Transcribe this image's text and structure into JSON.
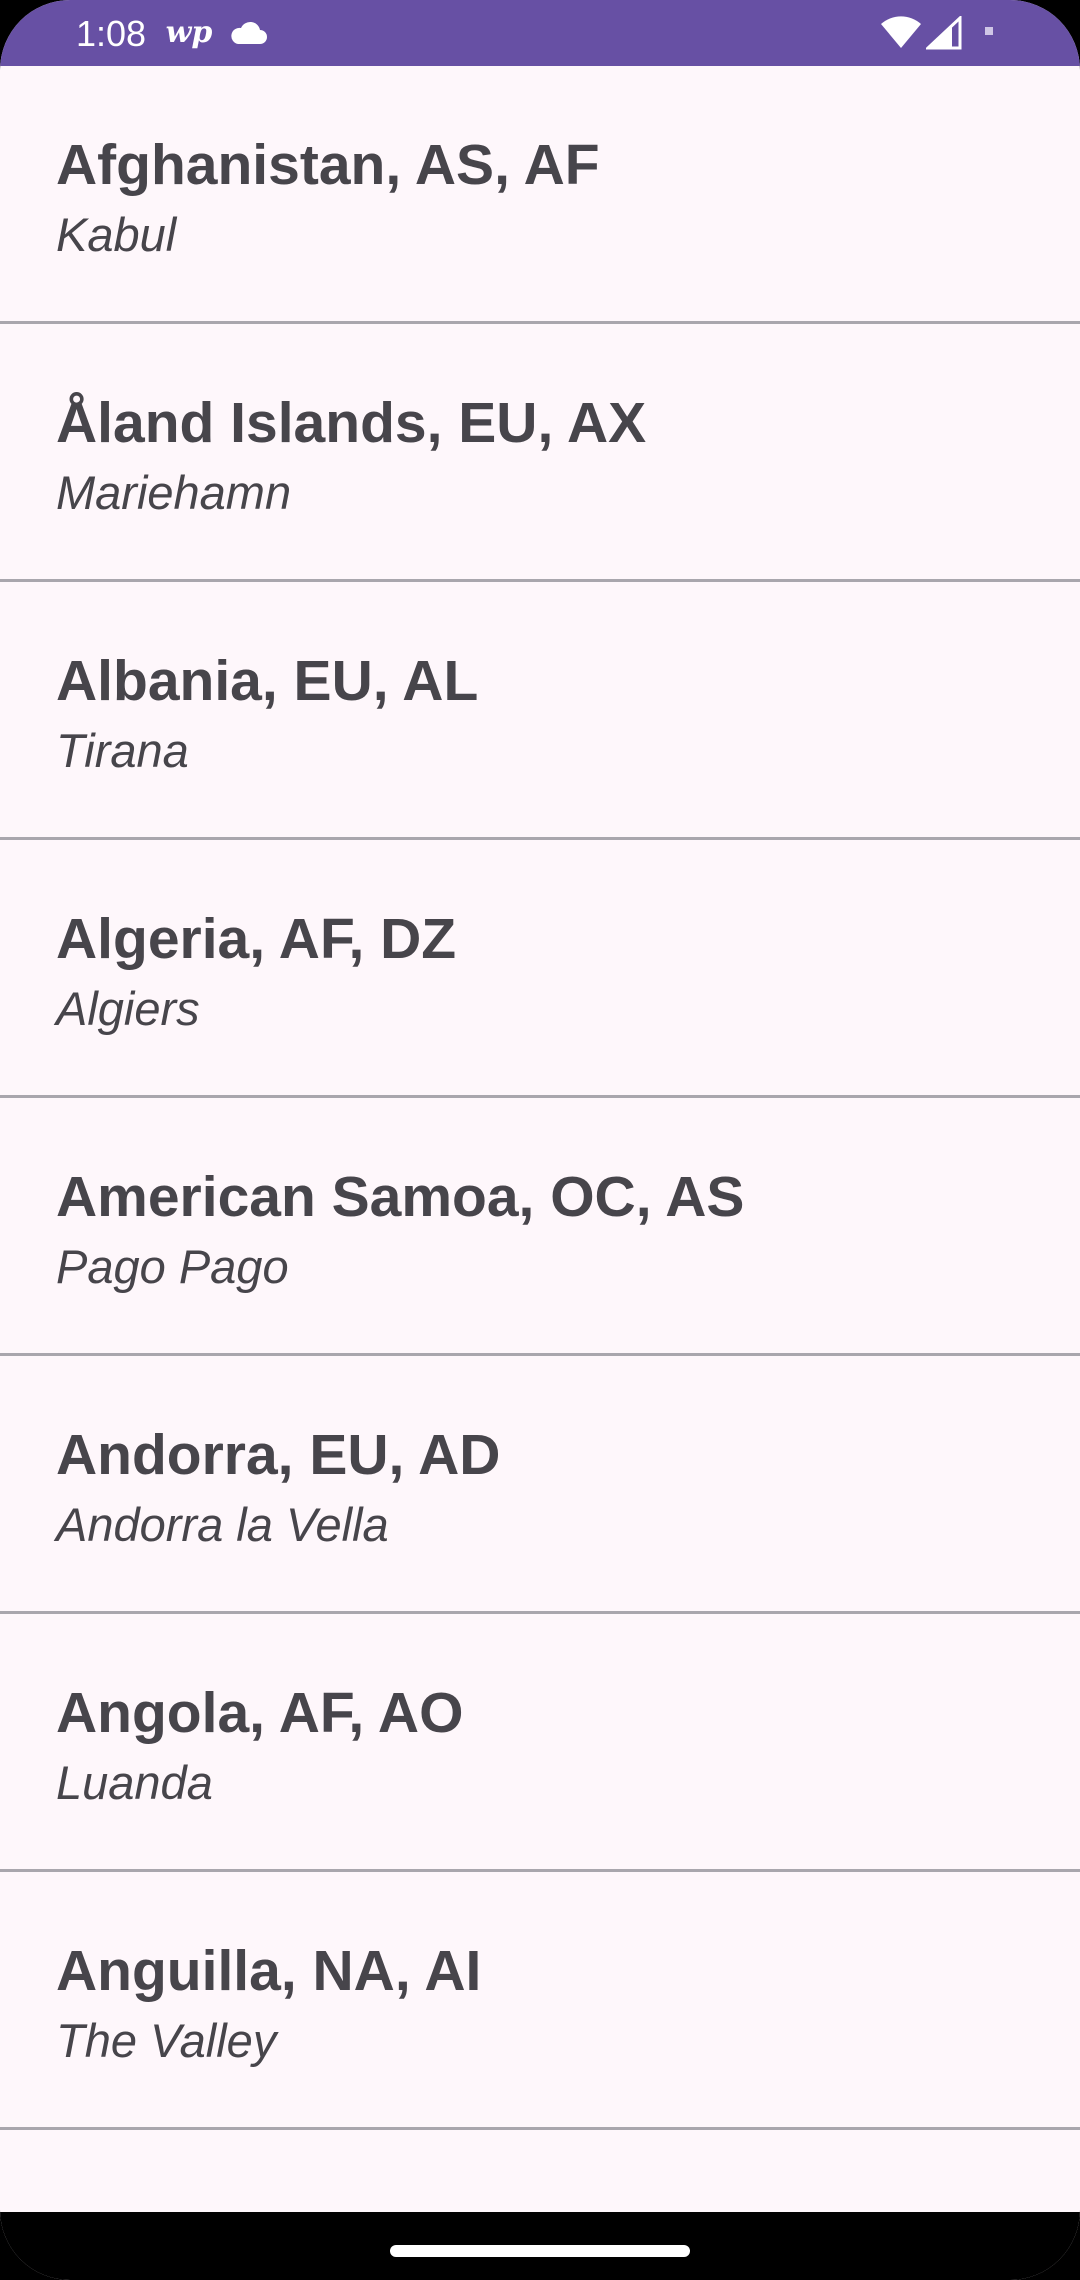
{
  "status_bar": {
    "time": "1:08",
    "icons": [
      "washington-post-icon",
      "cloud-icon",
      "wifi-icon",
      "cellular-signal-icon",
      "battery-icon"
    ],
    "background_color": "#6750a4"
  },
  "countries": [
    {
      "title": "Afghanistan, AS, AF",
      "capital": "Kabul"
    },
    {
      "title": "Åland Islands, EU, AX",
      "capital": "Mariehamn"
    },
    {
      "title": "Albania, EU, AL",
      "capital": "Tirana"
    },
    {
      "title": "Algeria, AF, DZ",
      "capital": "Algiers"
    },
    {
      "title": "American Samoa, OC, AS",
      "capital": "Pago Pago"
    },
    {
      "title": "Andorra, EU, AD",
      "capital": "Andorra la Vella"
    },
    {
      "title": "Angola, AF, AO",
      "capital": "Luanda"
    },
    {
      "title": "Anguilla, NA, AI",
      "capital": "The Valley"
    }
  ],
  "colors": {
    "list_background": "#fef7fb",
    "text": "#47454b",
    "divider": "#a9a6ad"
  }
}
